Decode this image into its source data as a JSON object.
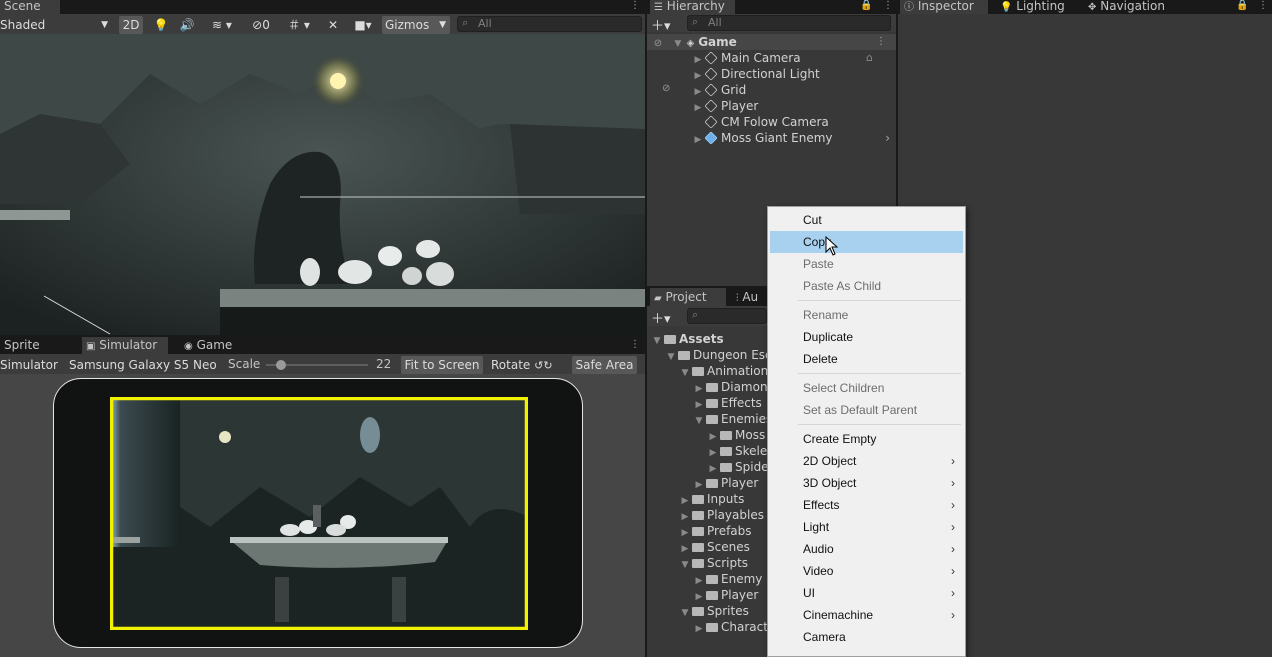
{
  "scene": {
    "tab": "Scene",
    "shading": "Shaded",
    "mode_2d": "2D",
    "gizmos": "Gizmos",
    "search_placeholder": "All"
  },
  "hierarchy": {
    "tab": "Hierarchy",
    "search_placeholder": "All",
    "root": "Game",
    "items": [
      {
        "label": "Main Camera",
        "expandable": true
      },
      {
        "label": "Directional Light",
        "expandable": true
      },
      {
        "label": "Grid",
        "expandable": true
      },
      {
        "label": "Player",
        "expandable": true
      },
      {
        "label": "CM Folow Camera",
        "expandable": false
      },
      {
        "label": "Moss Giant Enemy",
        "expandable": true
      }
    ]
  },
  "inspector_tabs": [
    "Inspector",
    "Lighting",
    "Navigation"
  ],
  "bottom_tabs": [
    "Sprite Editor",
    "Simulator",
    "Game"
  ],
  "simulator": {
    "mode": "Simulator",
    "device": "Samsung Galaxy S5 Neo",
    "scale_label": "Scale",
    "scale_value": "22",
    "scale_fraction": 0.15,
    "fit": "Fit to Screen",
    "rotate": "Rotate",
    "safe_area": "Safe Area"
  },
  "project": {
    "tabs": [
      "Project",
      "Au"
    ],
    "tree": [
      {
        "label": "Assets",
        "depth": 0,
        "bold": true
      },
      {
        "label": "Dungeon Esc",
        "depth": 1
      },
      {
        "label": "Animations",
        "depth": 2
      },
      {
        "label": "Diamon",
        "depth": 3
      },
      {
        "label": "Effects",
        "depth": 3
      },
      {
        "label": "Enemies",
        "depth": 3
      },
      {
        "label": "Moss",
        "depth": 4
      },
      {
        "label": "Skele",
        "depth": 4
      },
      {
        "label": "Spide",
        "depth": 4
      },
      {
        "label": "Player",
        "depth": 3
      },
      {
        "label": "Inputs",
        "depth": 2
      },
      {
        "label": "Playables",
        "depth": 2
      },
      {
        "label": "Prefabs",
        "depth": 2
      },
      {
        "label": "Scenes",
        "depth": 2
      },
      {
        "label": "Scripts",
        "depth": 2
      },
      {
        "label": "Enemy",
        "depth": 3
      },
      {
        "label": "Player",
        "depth": 3
      },
      {
        "label": "Sprites",
        "depth": 2
      },
      {
        "label": "Charact",
        "depth": 3
      }
    ]
  },
  "context_menu": {
    "items": [
      {
        "label": "Cut",
        "enabled": true
      },
      {
        "label": "Copy",
        "enabled": true,
        "highlighted": true
      },
      {
        "label": "Paste",
        "enabled": false
      },
      {
        "label": "Paste As Child",
        "enabled": false
      },
      {
        "label": "Rename",
        "enabled": false
      },
      {
        "label": "Duplicate",
        "enabled": true
      },
      {
        "label": "Delete",
        "enabled": true
      },
      {
        "label": "Select Children",
        "enabled": false
      },
      {
        "label": "Set as Default Parent",
        "enabled": false
      },
      {
        "label": "Create Empty",
        "enabled": true
      },
      {
        "label": "2D Object",
        "enabled": true,
        "submenu": true
      },
      {
        "label": "3D Object",
        "enabled": true,
        "submenu": true
      },
      {
        "label": "Effects",
        "enabled": true,
        "submenu": true
      },
      {
        "label": "Light",
        "enabled": true,
        "submenu": true
      },
      {
        "label": "Audio",
        "enabled": true,
        "submenu": true
      },
      {
        "label": "Video",
        "enabled": true,
        "submenu": true
      },
      {
        "label": "UI",
        "enabled": true,
        "submenu": true
      },
      {
        "label": "Cinemachine",
        "enabled": true,
        "submenu": true
      },
      {
        "label": "Camera",
        "enabled": true
      }
    ]
  },
  "colors": {
    "panel_bg": "#383838",
    "menu_bg": "#f0f0f0",
    "menu_highlight": "#a8d1f0",
    "safe_area_frame": "#f2f200"
  }
}
